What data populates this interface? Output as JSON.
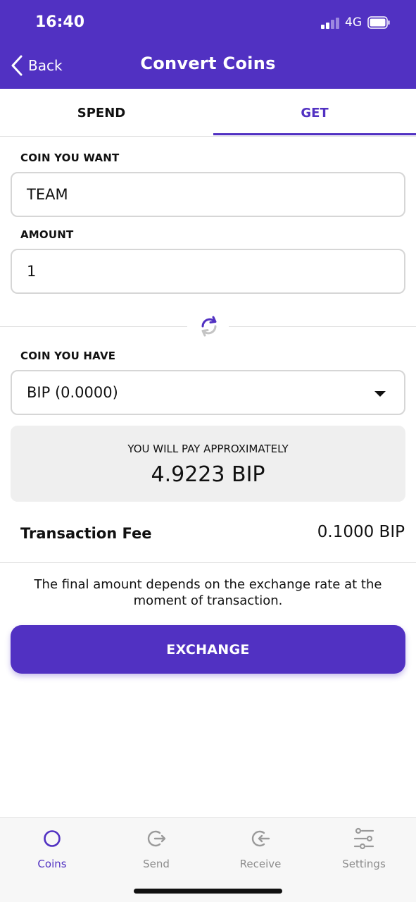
{
  "status_bar": {
    "time": "16:40",
    "network": "4G"
  },
  "nav": {
    "back_label": "Back",
    "title": "Convert Coins"
  },
  "tabs": [
    {
      "label": "SPEND",
      "active": false
    },
    {
      "label": "GET",
      "active": true
    }
  ],
  "form": {
    "coin_want_label": "COIN YOU WANT",
    "coin_want_value": "TEAM",
    "amount_label": "AMOUNT",
    "amount_value": "1",
    "coin_have_label": "COIN YOU HAVE",
    "coin_have_value": "BIP (0.0000)"
  },
  "estimate": {
    "label": "YOU WILL PAY APPROXIMATELY",
    "value": "4.9223 BIP"
  },
  "fee": {
    "label": "Transaction Fee",
    "value": "0.1000 BIP"
  },
  "note": "The final amount depends on the exchange rate at the moment of transaction.",
  "exchange_button": "EXCHANGE",
  "tabbar": [
    {
      "label": "Coins",
      "icon": "coins-icon",
      "active": true
    },
    {
      "label": "Send",
      "icon": "send-icon",
      "active": false
    },
    {
      "label": "Receive",
      "icon": "receive-icon",
      "active": false
    },
    {
      "label": "Settings",
      "icon": "settings-icon",
      "active": false
    }
  ],
  "colors": {
    "accent": "#5131C2",
    "field_border": "#d6d6d6",
    "pay_box": "#efefef",
    "inactive": "#8c8c8c"
  }
}
